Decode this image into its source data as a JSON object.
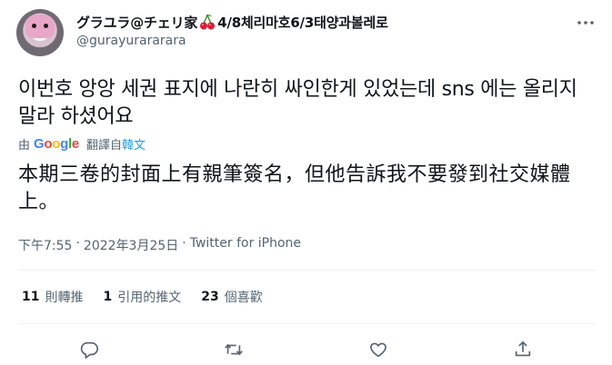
{
  "author": {
    "display_name_part1": "グラユラ@チェリ家",
    "display_name_part2": "4/8체리마호6/3태양과볼레로",
    "handle": "@gurayurararara",
    "cherry_icon": "cherry-icon",
    "avatar_icon": "avatar"
  },
  "tweet": {
    "text": "이번호 앙앙 세권 표지에 나란히 싸인한게 있었는데 sns 에는 올리지 말라 하셨어요"
  },
  "translation": {
    "by": "由",
    "google": [
      "G",
      "o",
      "o",
      "g",
      "l",
      "e"
    ],
    "translated_label": "翻譯自",
    "source_language": "韓文",
    "text": "本期三卷的封面上有親筆簽名，但他告訴我不要發到社交媒體上。"
  },
  "meta": {
    "time": "下午7:55",
    "separator1": "·",
    "date": "2022年3月25日",
    "separator2": "·",
    "source": "Twitter for iPhone"
  },
  "stats": {
    "retweets_count": "11",
    "retweets_label": "則轉推",
    "quotes_count": "1",
    "quotes_label": "引用的推文",
    "likes_count": "23",
    "likes_label": "個喜歡"
  },
  "actions": [
    "reply-icon",
    "retweet-icon",
    "like-icon",
    "share-icon"
  ],
  "colors": {
    "accent": "#1d9bf0",
    "secondary_text": "#536471",
    "primary_text": "#0f1419",
    "divider": "#eff3f4"
  }
}
